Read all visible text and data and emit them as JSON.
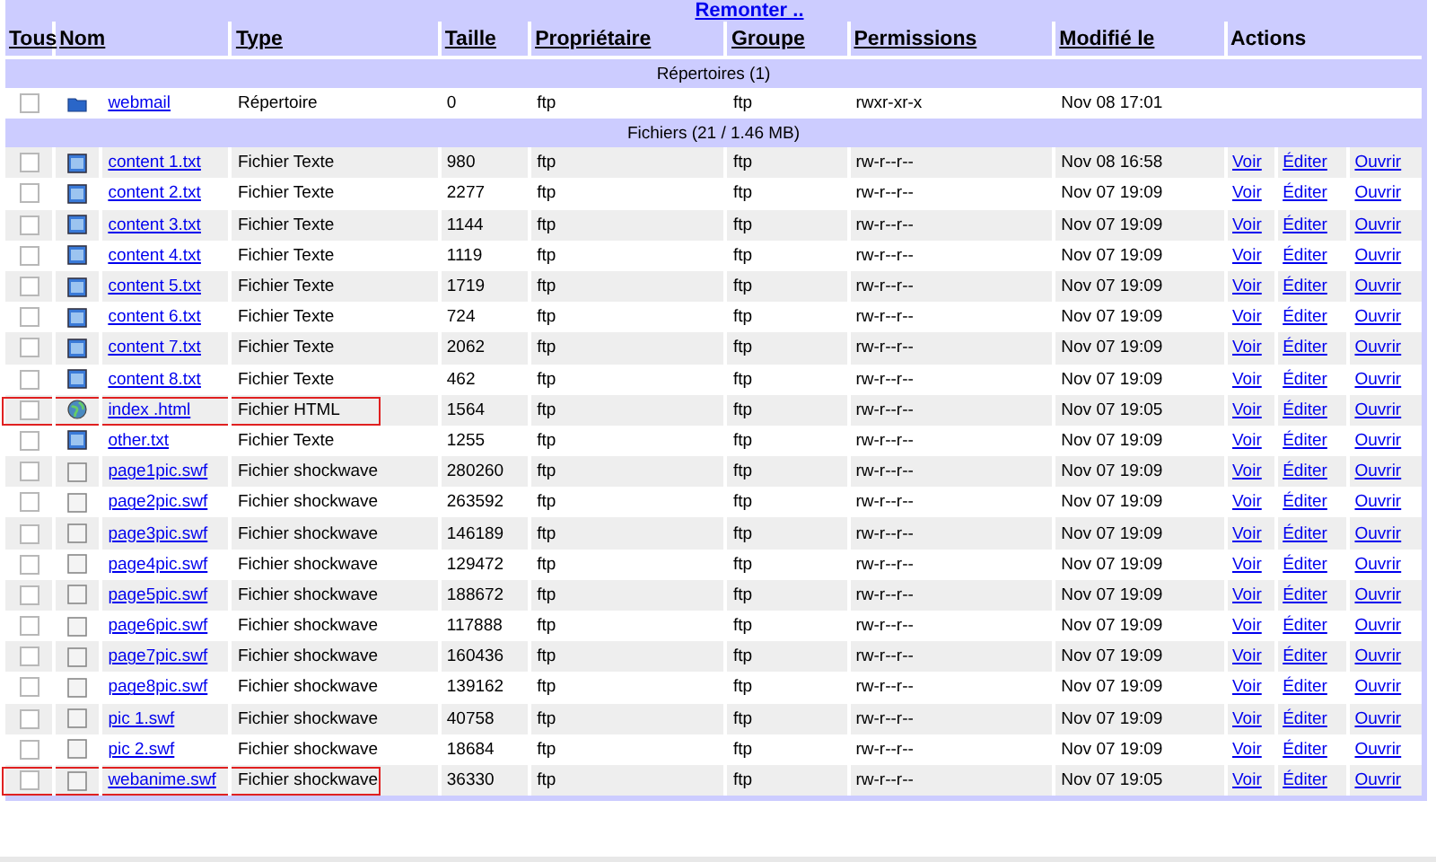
{
  "up_link": "Remonter ..",
  "columns": [
    {
      "label": "Tous",
      "sortable": true
    },
    {
      "label": "Nom",
      "sortable": true
    },
    {
      "label": "Type",
      "sortable": true
    },
    {
      "label": "Taille",
      "sortable": true
    },
    {
      "label": "Propriétaire",
      "sortable": true
    },
    {
      "label": "Groupe",
      "sortable": true
    },
    {
      "label": "Permissions",
      "sortable": true
    },
    {
      "label": "Modifié le",
      "sortable": true
    },
    {
      "label": "Actions",
      "sortable": false
    }
  ],
  "directories_heading": "Répertoires (1)",
  "directories": [
    {
      "kind": "folder",
      "name": "webmail",
      "type": "Répertoire",
      "size": "0",
      "owner": "ftp",
      "group": "ftp",
      "permissions": "rwxr-xr-x",
      "modified": "Nov 08 17:01",
      "checked": false
    }
  ],
  "files_heading": "Fichiers (21 / 1.46 MB)",
  "files": [
    {
      "kind": "text",
      "name": "content 1.txt",
      "type": "Fichier Texte",
      "size": "980",
      "owner": "ftp",
      "group": "ftp",
      "permissions": "rw-r--r--",
      "modified": "Nov 08 16:58",
      "checked": false,
      "highlighted": false,
      "actions": [
        "Voir",
        "Éditer",
        "Ouvrir"
      ]
    },
    {
      "kind": "text",
      "name": "content 2.txt",
      "type": "Fichier Texte",
      "size": "2277",
      "owner": "ftp",
      "group": "ftp",
      "permissions": "rw-r--r--",
      "modified": "Nov 07 19:09",
      "checked": false,
      "highlighted": false,
      "actions": [
        "Voir",
        "Éditer",
        "Ouvrir"
      ]
    },
    {
      "kind": "text",
      "name": "content 3.txt",
      "type": "Fichier Texte",
      "size": "1144",
      "owner": "ftp",
      "group": "ftp",
      "permissions": "rw-r--r--",
      "modified": "Nov 07 19:09",
      "checked": false,
      "highlighted": false,
      "actions": [
        "Voir",
        "Éditer",
        "Ouvrir"
      ]
    },
    {
      "kind": "text",
      "name": "content 4.txt",
      "type": "Fichier Texte",
      "size": "1119",
      "owner": "ftp",
      "group": "ftp",
      "permissions": "rw-r--r--",
      "modified": "Nov 07 19:09",
      "checked": false,
      "highlighted": false,
      "actions": [
        "Voir",
        "Éditer",
        "Ouvrir"
      ]
    },
    {
      "kind": "text",
      "name": "content 5.txt",
      "type": "Fichier Texte",
      "size": "1719",
      "owner": "ftp",
      "group": "ftp",
      "permissions": "rw-r--r--",
      "modified": "Nov 07 19:09",
      "checked": false,
      "highlighted": false,
      "actions": [
        "Voir",
        "Éditer",
        "Ouvrir"
      ]
    },
    {
      "kind": "text",
      "name": "content 6.txt",
      "type": "Fichier Texte",
      "size": "724",
      "owner": "ftp",
      "group": "ftp",
      "permissions": "rw-r--r--",
      "modified": "Nov 07 19:09",
      "checked": false,
      "highlighted": false,
      "actions": [
        "Voir",
        "Éditer",
        "Ouvrir"
      ]
    },
    {
      "kind": "text",
      "name": "content 7.txt",
      "type": "Fichier Texte",
      "size": "2062",
      "owner": "ftp",
      "group": "ftp",
      "permissions": "rw-r--r--",
      "modified": "Nov 07 19:09",
      "checked": false,
      "highlighted": false,
      "actions": [
        "Voir",
        "Éditer",
        "Ouvrir"
      ]
    },
    {
      "kind": "text",
      "name": "content 8.txt",
      "type": "Fichier Texte",
      "size": "462",
      "owner": "ftp",
      "group": "ftp",
      "permissions": "rw-r--r--",
      "modified": "Nov 07 19:09",
      "checked": false,
      "highlighted": false,
      "actions": [
        "Voir",
        "Éditer",
        "Ouvrir"
      ]
    },
    {
      "kind": "html",
      "name": "index .html",
      "type": "Fichier HTML",
      "size": "1564",
      "owner": "ftp",
      "group": "ftp",
      "permissions": "rw-r--r--",
      "modified": "Nov 07 19:05",
      "checked": false,
      "highlighted": true,
      "actions": [
        "Voir",
        "Éditer",
        "Ouvrir"
      ]
    },
    {
      "kind": "text",
      "name": "other.txt",
      "type": "Fichier Texte",
      "size": "1255",
      "owner": "ftp",
      "group": "ftp",
      "permissions": "rw-r--r--",
      "modified": "Nov 07 19:09",
      "checked": false,
      "highlighted": false,
      "actions": [
        "Voir",
        "Éditer",
        "Ouvrir"
      ]
    },
    {
      "kind": "swf",
      "name": "page1pic.swf",
      "type": "Fichier shockwave",
      "size": "280260",
      "owner": "ftp",
      "group": "ftp",
      "permissions": "rw-r--r--",
      "modified": "Nov 07 19:09",
      "checked": false,
      "highlighted": false,
      "actions": [
        "Voir",
        "Éditer",
        "Ouvrir"
      ]
    },
    {
      "kind": "swf",
      "name": "page2pic.swf",
      "type": "Fichier shockwave",
      "size": "263592",
      "owner": "ftp",
      "group": "ftp",
      "permissions": "rw-r--r--",
      "modified": "Nov 07 19:09",
      "checked": false,
      "highlighted": false,
      "actions": [
        "Voir",
        "Éditer",
        "Ouvrir"
      ]
    },
    {
      "kind": "swf",
      "name": "page3pic.swf",
      "type": "Fichier shockwave",
      "size": "146189",
      "owner": "ftp",
      "group": "ftp",
      "permissions": "rw-r--r--",
      "modified": "Nov 07 19:09",
      "checked": false,
      "highlighted": false,
      "actions": [
        "Voir",
        "Éditer",
        "Ouvrir"
      ]
    },
    {
      "kind": "swf",
      "name": "page4pic.swf",
      "type": "Fichier shockwave",
      "size": "129472",
      "owner": "ftp",
      "group": "ftp",
      "permissions": "rw-r--r--",
      "modified": "Nov 07 19:09",
      "checked": false,
      "highlighted": false,
      "actions": [
        "Voir",
        "Éditer",
        "Ouvrir"
      ]
    },
    {
      "kind": "swf",
      "name": "page5pic.swf",
      "type": "Fichier shockwave",
      "size": "188672",
      "owner": "ftp",
      "group": "ftp",
      "permissions": "rw-r--r--",
      "modified": "Nov 07 19:09",
      "checked": false,
      "highlighted": false,
      "actions": [
        "Voir",
        "Éditer",
        "Ouvrir"
      ]
    },
    {
      "kind": "swf",
      "name": "page6pic.swf",
      "type": "Fichier shockwave",
      "size": "117888",
      "owner": "ftp",
      "group": "ftp",
      "permissions": "rw-r--r--",
      "modified": "Nov 07 19:09",
      "checked": false,
      "highlighted": false,
      "actions": [
        "Voir",
        "Éditer",
        "Ouvrir"
      ]
    },
    {
      "kind": "swf",
      "name": "page7pic.swf",
      "type": "Fichier shockwave",
      "size": "160436",
      "owner": "ftp",
      "group": "ftp",
      "permissions": "rw-r--r--",
      "modified": "Nov 07 19:09",
      "checked": false,
      "highlighted": false,
      "actions": [
        "Voir",
        "Éditer",
        "Ouvrir"
      ]
    },
    {
      "kind": "swf",
      "name": "page8pic.swf",
      "type": "Fichier shockwave",
      "size": "139162",
      "owner": "ftp",
      "group": "ftp",
      "permissions": "rw-r--r--",
      "modified": "Nov 07 19:09",
      "checked": false,
      "highlighted": false,
      "actions": [
        "Voir",
        "Éditer",
        "Ouvrir"
      ]
    },
    {
      "kind": "swf",
      "name": "pic 1.swf",
      "type": "Fichier shockwave",
      "size": "40758",
      "owner": "ftp",
      "group": "ftp",
      "permissions": "rw-r--r--",
      "modified": "Nov 07 19:09",
      "checked": false,
      "highlighted": false,
      "actions": [
        "Voir",
        "Éditer",
        "Ouvrir"
      ]
    },
    {
      "kind": "swf",
      "name": "pic 2.swf",
      "type": "Fichier shockwave",
      "size": "18684",
      "owner": "ftp",
      "group": "ftp",
      "permissions": "rw-r--r--",
      "modified": "Nov 07 19:09",
      "checked": false,
      "highlighted": false,
      "actions": [
        "Voir",
        "Éditer",
        "Ouvrir"
      ]
    },
    {
      "kind": "swf",
      "name": "webanime.swf",
      "type": "Fichier shockwave",
      "size": "36330",
      "owner": "ftp",
      "group": "ftp",
      "permissions": "rw-r--r--",
      "modified": "Nov 07 19:05",
      "checked": false,
      "highlighted": true,
      "actions": [
        "Voir",
        "Éditer",
        "Ouvrir"
      ]
    }
  ]
}
